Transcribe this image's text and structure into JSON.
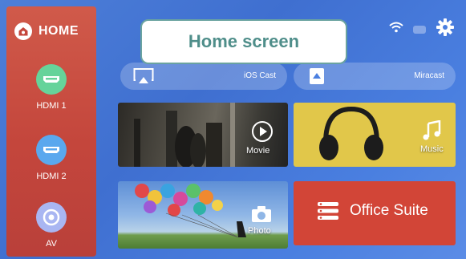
{
  "caption": "Home screen",
  "sidebar": {
    "home_label": "HOME",
    "sources": [
      {
        "label": "HDMI 1",
        "icon": "hdmi-port-icon",
        "color": "#66d39a"
      },
      {
        "label": "HDMI 2",
        "icon": "hdmi-port-icon",
        "color": "#5aa8ee"
      },
      {
        "label": "AV",
        "icon": "av-input-icon",
        "color": "#a9b6f2"
      }
    ]
  },
  "status": {
    "icons": [
      "wifi-icon",
      "bluetooth-icon",
      "gear-icon"
    ]
  },
  "cast": {
    "ios": {
      "label": "iOS Cast",
      "icon": "airplay-icon"
    },
    "miracast": {
      "label": "Miracast",
      "icon": "miracast-icon"
    }
  },
  "tiles": {
    "movie": {
      "label": "Movie",
      "icon": "play-icon"
    },
    "music": {
      "label": "Music",
      "icon": "music-note-icon"
    },
    "photo": {
      "label": "Photo",
      "icon": "camera-icon"
    },
    "office": {
      "label": "Office Suite",
      "icon": "list-icon"
    }
  },
  "colors": {
    "background": "#4a7fe0",
    "sidebar": "#c4463c",
    "music_tile": "#e1c74a",
    "office_tile": "#d24537",
    "caption_text": "#4f8e8a"
  }
}
